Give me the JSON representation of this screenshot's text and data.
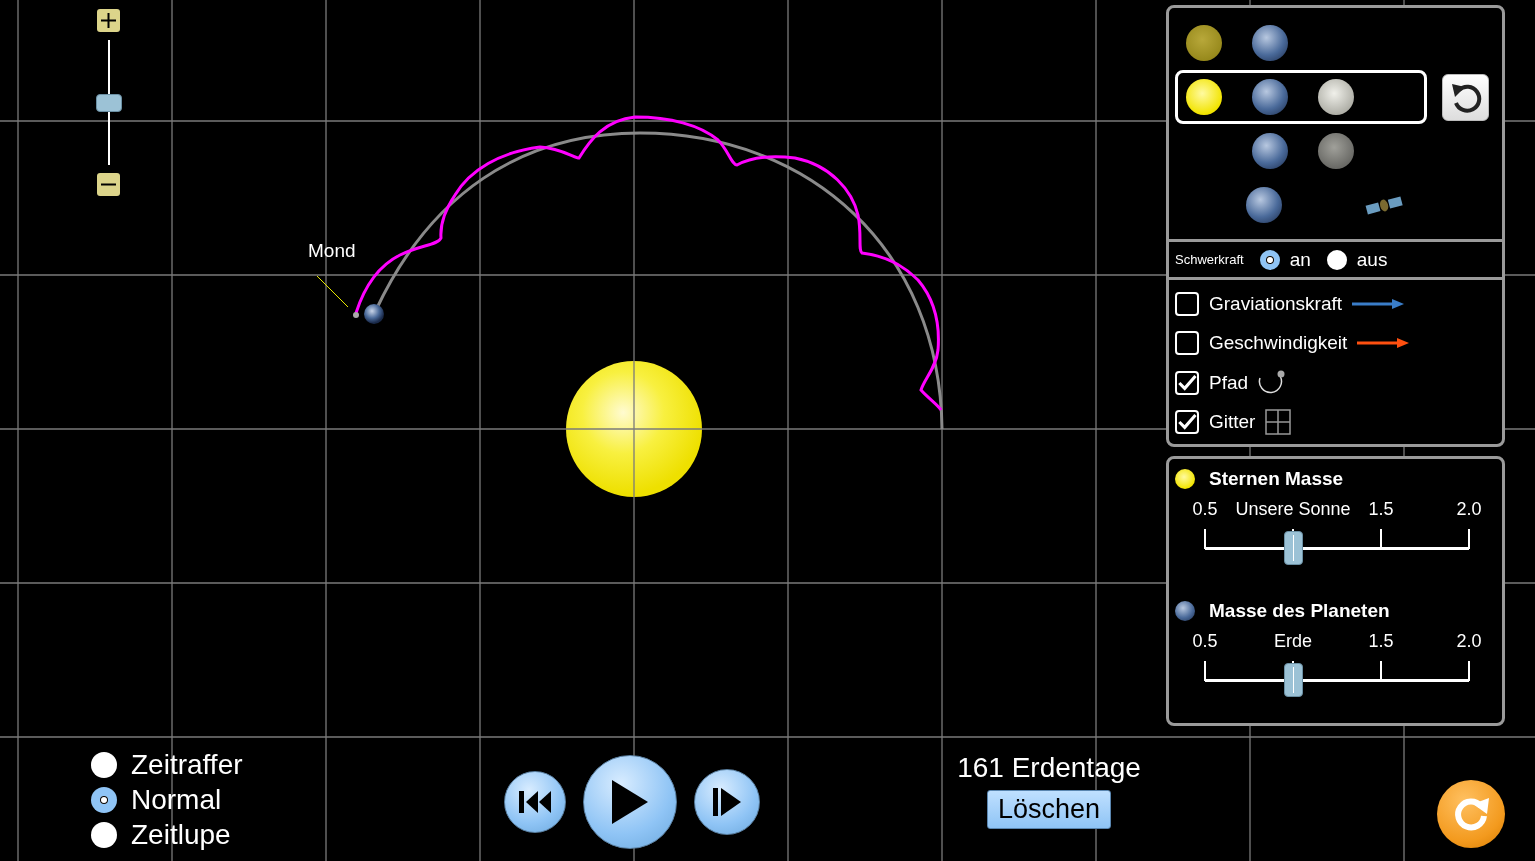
{
  "zoom_slider": {
    "level": 0.5
  },
  "moon_label": "Mond",
  "body_selector": {
    "rows": [
      {
        "selected": false,
        "bodies": [
          {
            "kind": "star-dim"
          },
          {
            "kind": "earth"
          }
        ]
      },
      {
        "selected": true,
        "bodies": [
          {
            "kind": "star"
          },
          {
            "kind": "earth"
          },
          {
            "kind": "moon"
          }
        ]
      },
      {
        "selected": false,
        "bodies": [
          {
            "kind": "empty"
          },
          {
            "kind": "earth"
          },
          {
            "kind": "moon-dark"
          }
        ]
      },
      {
        "selected": false,
        "bodies": [
          {
            "kind": "empty"
          },
          {
            "kind": "earth"
          },
          {
            "kind": "empty"
          },
          {
            "kind": "satellite"
          }
        ]
      }
    ]
  },
  "gravity": {
    "label": "Schwerkraft",
    "options": [
      {
        "label": "an",
        "selected": true
      },
      {
        "label": "aus",
        "selected": false
      }
    ]
  },
  "display_options": [
    {
      "label": "Graviationskraft",
      "checked": false,
      "kind": "force"
    },
    {
      "label": "Geschwindigkeit",
      "checked": false,
      "kind": "velocity"
    },
    {
      "label": "Pfad",
      "checked": true,
      "kind": "path"
    },
    {
      "label": "Gitter",
      "checked": true,
      "kind": "grid"
    }
  ],
  "mass_sliders": [
    {
      "title": "Sternen Masse",
      "kind": "star",
      "ticks": [
        "0.5",
        "Unsere Sonne",
        "1.5",
        "2.0"
      ],
      "level": 0.333
    },
    {
      "title": "Masse des Planeten",
      "kind": "earth",
      "ticks": [
        "0.5",
        "Erde",
        "1.5",
        "2.0"
      ],
      "level": 0.333
    }
  ],
  "speed_options": [
    {
      "label": "Zeitraffer",
      "selected": false
    },
    {
      "label": "Normal",
      "selected": true
    },
    {
      "label": "Zeitlupe",
      "selected": false
    }
  ],
  "playback": [
    {
      "kind": "rewind"
    },
    {
      "kind": "play"
    },
    {
      "kind": "step"
    }
  ],
  "elapsed_time": "161 Erdentage",
  "clear_button": "Löschen"
}
